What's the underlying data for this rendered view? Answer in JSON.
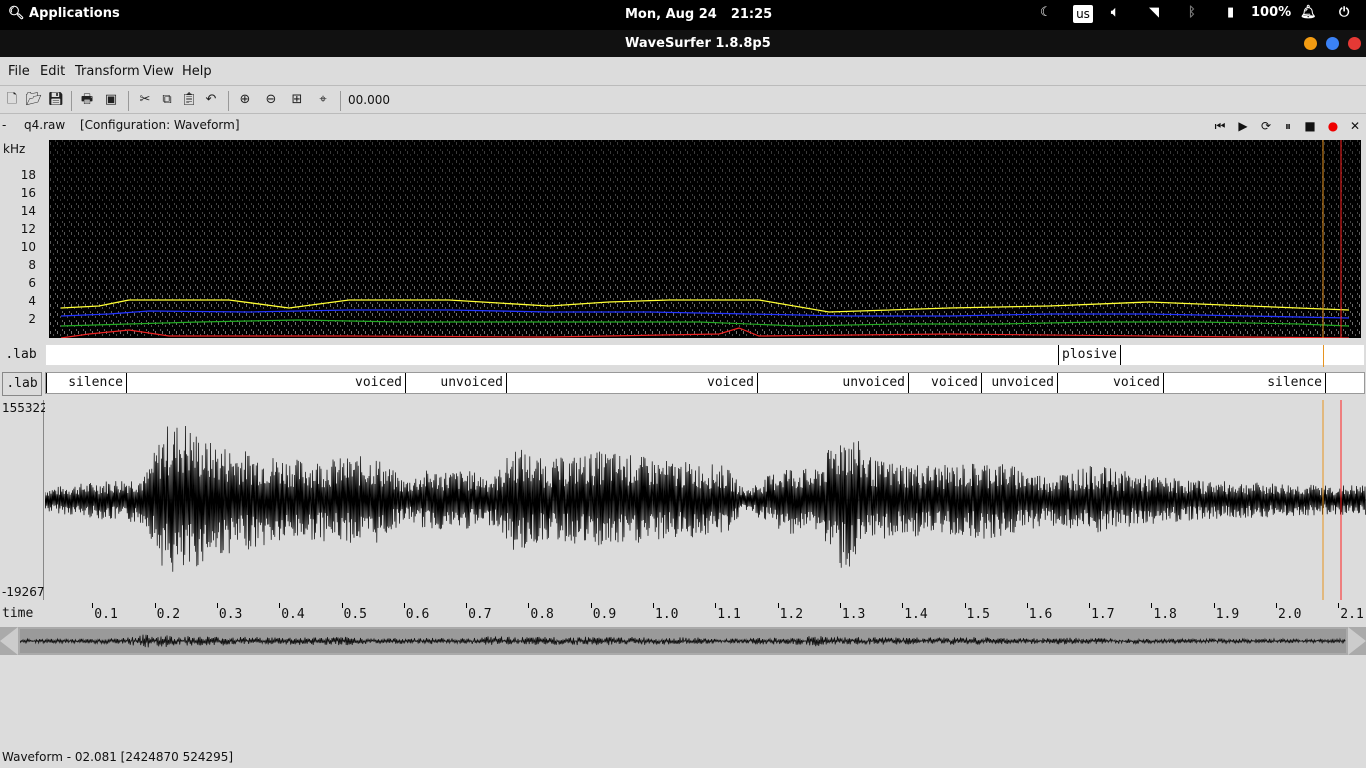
{
  "topbar": {
    "apps_label": "Applications",
    "date": "Mon, Aug 24",
    "time": "21:25",
    "kbd_layout": "us",
    "battery": "100%"
  },
  "window": {
    "title": "WaveSurfer 1.8.8p5",
    "buttons": {
      "minimize": "#f39c12",
      "maximize": "#3b82f6",
      "close": "#e53935"
    }
  },
  "menu": {
    "file": "File",
    "edit": "Edit",
    "transform": "Transform",
    "view": "View",
    "help": "Help"
  },
  "toolbar": {
    "time_readout": "00.000"
  },
  "info": {
    "dash": "-",
    "filename": "q4.raw",
    "configuration": "[Configuration: Waveform]"
  },
  "spectrogram": {
    "unit": "kHz",
    "y_ticks": [
      "18",
      "16",
      "14",
      "12",
      "10",
      "8",
      "6",
      "4",
      "2"
    ]
  },
  "label_tracks": [
    {
      "name": ".lab",
      "segments": [
        {
          "label": "plosive"
        }
      ]
    },
    {
      "name": ".lab",
      "segments": [
        {
          "label": "silence"
        },
        {
          "label": "voiced"
        },
        {
          "label": "unvoiced"
        },
        {
          "label": "voiced"
        },
        {
          "label": "unvoiced"
        },
        {
          "label": "voiced"
        },
        {
          "label": "unvoiced"
        },
        {
          "label": "voiced"
        },
        {
          "label": "silence"
        }
      ]
    }
  ],
  "waveform": {
    "y_max": "155322",
    "y_min": "-19267"
  },
  "time_axis": {
    "label": "time",
    "ticks": [
      "0.1",
      "0.2",
      "0.3",
      "0.4",
      "0.5",
      "0.6",
      "0.7",
      "0.8",
      "0.9",
      "1.0",
      "1.1",
      "1.2",
      "1.3",
      "1.4",
      "1.5",
      "1.6",
      "1.7",
      "1.8",
      "1.9",
      "2.0",
      "2.1"
    ]
  },
  "status": {
    "text": "Waveform - 02.081 [2424870 524295]"
  }
}
